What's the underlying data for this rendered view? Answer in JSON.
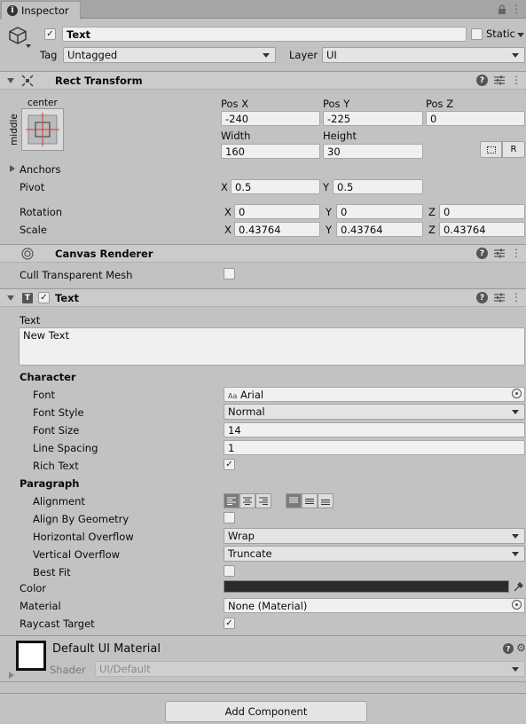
{
  "window": {
    "tab_label": "Inspector"
  },
  "object": {
    "name": "Text",
    "static_label": "Static",
    "tag_label": "Tag",
    "tag_value": "Untagged",
    "layer_label": "Layer",
    "layer_value": "UI"
  },
  "rect_transform": {
    "title": "Rect Transform",
    "anchor_h": "center",
    "anchor_v": "middle",
    "pos_x_label": "Pos X",
    "pos_y_label": "Pos Y",
    "pos_z_label": "Pos Z",
    "pos_x": "-240",
    "pos_y": "-225",
    "pos_z": "0",
    "width_label": "Width",
    "height_label": "Height",
    "width": "160",
    "height": "30",
    "r_button": "R",
    "anchors_label": "Anchors",
    "pivot_label": "Pivot",
    "pivot_x": "0.5",
    "pivot_y": "0.5",
    "rotation_label": "Rotation",
    "rot_x": "0",
    "rot_y": "0",
    "rot_z": "0",
    "scale_label": "Scale",
    "scale_x": "0.43764",
    "scale_y": "0.43764",
    "scale_z": "0.43764",
    "x": "X",
    "y": "Y",
    "z": "Z"
  },
  "canvas_renderer": {
    "title": "Canvas Renderer",
    "cull_label": "Cull Transparent Mesh"
  },
  "text_component": {
    "title": "Text",
    "text_label": "Text",
    "text_value": "New Text",
    "character_header": "Character",
    "font_label": "Font",
    "font_value": "Arial",
    "font_prefix": "Aa",
    "font_style_label": "Font Style",
    "font_style_value": "Normal",
    "font_size_label": "Font Size",
    "font_size_value": "14",
    "line_spacing_label": "Line Spacing",
    "line_spacing_value": "1",
    "rich_text_label": "Rich Text",
    "paragraph_header": "Paragraph",
    "alignment_label": "Alignment",
    "align_geometry_label": "Align By Geometry",
    "h_overflow_label": "Horizontal Overflow",
    "h_overflow_value": "Wrap",
    "v_overflow_label": "Vertical Overflow",
    "v_overflow_value": "Truncate",
    "best_fit_label": "Best Fit",
    "color_label": "Color",
    "color_value": "#2b2b2b",
    "material_label": "Material",
    "material_value": "None (Material)",
    "raycast_label": "Raycast Target"
  },
  "material": {
    "title": "Default UI Material",
    "shader_label": "Shader",
    "shader_value": "UI/Default"
  },
  "footer": {
    "add_component": "Add Component"
  }
}
